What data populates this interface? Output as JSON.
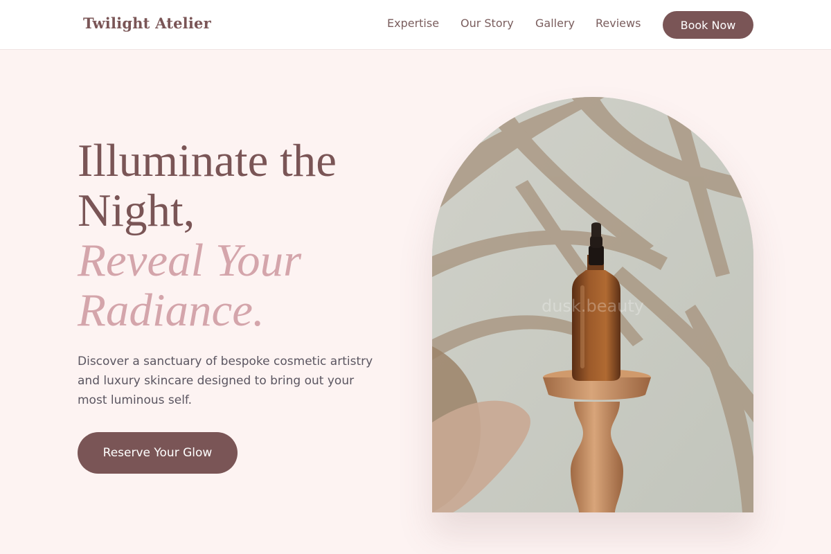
{
  "brand": {
    "name": "Twilight Atelier"
  },
  "nav": {
    "links": [
      "Expertise",
      "Our Story",
      "Gallery",
      "Reviews"
    ],
    "cta_label": "Book Now"
  },
  "hero": {
    "heading_line1": "Illuminate the",
    "heading_line2": "Night,",
    "heading_accent_line1": "Reveal Your",
    "heading_accent_line2": "Radiance.",
    "description_lines": [
      "Discover a sanctuary of bespoke cosmetic artistry",
      "and luxury skincare designed to bring out your",
      "most luminous self."
    ],
    "cta_label": "Reserve Your Glow",
    "image_watermark": "dusk.beauty"
  },
  "colors": {
    "accent": "#7a5556",
    "accent_soft": "#d4a5ab",
    "page_background": "#fdf3f2",
    "header_background": "#ffffff"
  }
}
